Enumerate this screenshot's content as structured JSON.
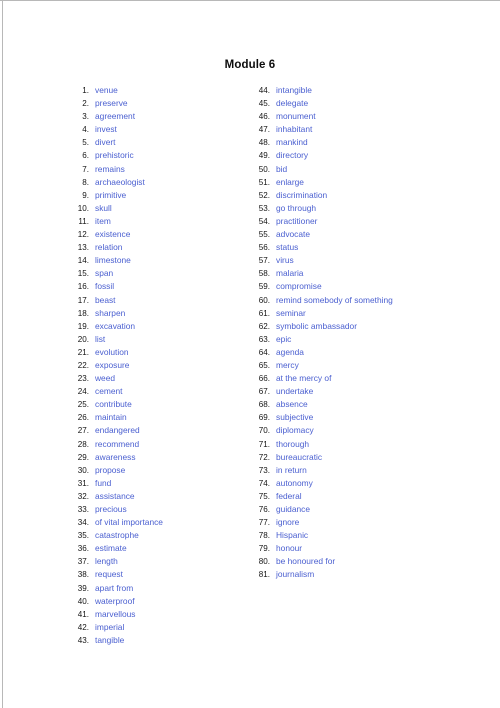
{
  "document": {
    "title": "Module 6"
  },
  "columns": {
    "left": [
      {
        "num": "1.",
        "word": "venue"
      },
      {
        "num": "2.",
        "word": "preserve"
      },
      {
        "num": "3.",
        "word": "agreement"
      },
      {
        "num": "4.",
        "word": "invest"
      },
      {
        "num": "5.",
        "word": "divert"
      },
      {
        "num": "6.",
        "word": "prehistoric"
      },
      {
        "num": "7.",
        "word": "remains"
      },
      {
        "num": "8.",
        "word": "archaeologist"
      },
      {
        "num": "9.",
        "word": "primitive"
      },
      {
        "num": "10.",
        "word": "skull"
      },
      {
        "num": "11.",
        "word": "item"
      },
      {
        "num": "12.",
        "word": "existence"
      },
      {
        "num": "13.",
        "word": "relation"
      },
      {
        "num": "14.",
        "word": "limestone"
      },
      {
        "num": "15.",
        "word": "span"
      },
      {
        "num": "16.",
        "word": "fossil"
      },
      {
        "num": "17.",
        "word": "beast"
      },
      {
        "num": "18.",
        "word": "sharpen"
      },
      {
        "num": "19.",
        "word": "excavation"
      },
      {
        "num": "20.",
        "word": "list"
      },
      {
        "num": "21.",
        "word": "evolution"
      },
      {
        "num": "22.",
        "word": "exposure"
      },
      {
        "num": "23.",
        "word": "weed"
      },
      {
        "num": "24.",
        "word": "cement"
      },
      {
        "num": "25.",
        "word": "contribute"
      },
      {
        "num": "26.",
        "word": "maintain"
      },
      {
        "num": "27.",
        "word": "endangered"
      },
      {
        "num": "28.",
        "word": "recommend"
      },
      {
        "num": "29.",
        "word": "awareness"
      },
      {
        "num": "30.",
        "word": "propose"
      },
      {
        "num": "31.",
        "word": "fund"
      },
      {
        "num": "32.",
        "word": "assistance"
      },
      {
        "num": "33.",
        "word": "precious"
      },
      {
        "num": "34.",
        "word": "of vital importance"
      },
      {
        "num": "35.",
        "word": "catastrophe"
      },
      {
        "num": "36.",
        "word": "estimate"
      },
      {
        "num": "37.",
        "word": "length"
      },
      {
        "num": "38.",
        "word": "request"
      },
      {
        "num": "39.",
        "word": "apart from"
      },
      {
        "num": "40.",
        "word": "waterproof"
      },
      {
        "num": "41.",
        "word": "marvellous"
      },
      {
        "num": "42.",
        "word": "imperial"
      },
      {
        "num": "43.",
        "word": "tangible"
      }
    ],
    "right": [
      {
        "num": "44.",
        "word": "intangible"
      },
      {
        "num": "45.",
        "word": "delegate"
      },
      {
        "num": "46.",
        "word": "monument"
      },
      {
        "num": "47.",
        "word": "inhabitant"
      },
      {
        "num": "48.",
        "word": "mankind"
      },
      {
        "num": "49.",
        "word": "directory"
      },
      {
        "num": "50.",
        "word": "bid"
      },
      {
        "num": "51.",
        "word": "enlarge"
      },
      {
        "num": "52.",
        "word": "discrimination"
      },
      {
        "num": "53.",
        "word": "go through"
      },
      {
        "num": "54.",
        "word": "practitioner"
      },
      {
        "num": "55.",
        "word": "advocate"
      },
      {
        "num": "56.",
        "word": "status"
      },
      {
        "num": "57.",
        "word": "virus"
      },
      {
        "num": "58.",
        "word": "malaria"
      },
      {
        "num": "59.",
        "word": "compromise"
      },
      {
        "num": "60.",
        "word": "remind somebody of something"
      },
      {
        "num": "61.",
        "word": "seminar"
      },
      {
        "num": "62.",
        "word": "symbolic ambassador"
      },
      {
        "num": "63.",
        "word": "epic"
      },
      {
        "num": "64.",
        "word": "agenda"
      },
      {
        "num": "65.",
        "word": "mercy"
      },
      {
        "num": "66.",
        "word": "at the mercy of"
      },
      {
        "num": "67.",
        "word": "undertake"
      },
      {
        "num": "68.",
        "word": "absence"
      },
      {
        "num": "69.",
        "word": "subjective"
      },
      {
        "num": "70.",
        "word": "diplomacy"
      },
      {
        "num": "71.",
        "word": "thorough"
      },
      {
        "num": "72.",
        "word": "bureaucratic"
      },
      {
        "num": "73.",
        "word": "in return"
      },
      {
        "num": "74.",
        "word": "autonomy"
      },
      {
        "num": "75.",
        "word": "federal"
      },
      {
        "num": "76.",
        "word": "guidance"
      },
      {
        "num": "77.",
        "word": "ignore"
      },
      {
        "num": "78.",
        "word": "Hispanic"
      },
      {
        "num": "79.",
        "word": "honour"
      },
      {
        "num": "80.",
        "word": "be honoured for"
      },
      {
        "num": "81.",
        "word": "journalism"
      }
    ]
  },
  "colors": {
    "word_text": "#4a5fd0",
    "number_text": "#151515",
    "title_text": "#0d0d0d",
    "page_background": "#ffffff",
    "page_edge_rule": "#b8b8b8"
  }
}
